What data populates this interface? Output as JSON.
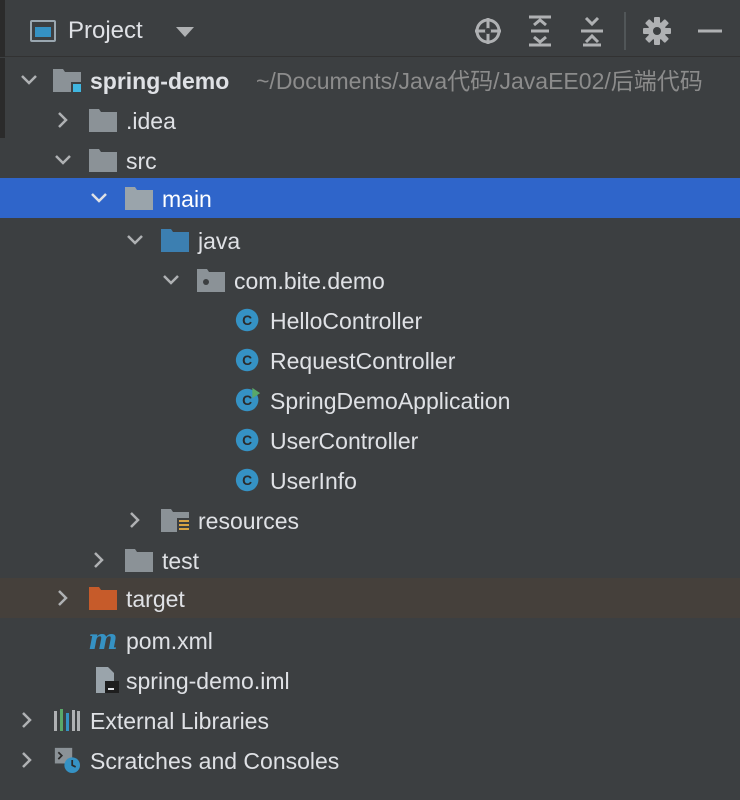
{
  "header": {
    "title": "Project",
    "icons": [
      "project-view-icon",
      "chevron-down-icon",
      "locate-icon",
      "expand-all-icon",
      "collapse-all-icon",
      "gear-icon",
      "minimize-icon"
    ]
  },
  "tree": {
    "root": {
      "name": "spring-demo",
      "path": "~/Documents/Java代码/JavaEE02/后端代码"
    },
    "idea": ".idea",
    "src": "src",
    "main": "main",
    "java": "java",
    "package": "com.bite.demo",
    "classes": {
      "c0": "HelloController",
      "c1": "RequestController",
      "c2": "SpringDemoApplication",
      "c3": "UserController",
      "c4": "UserInfo"
    },
    "resources": "resources",
    "test": "test",
    "target": "target",
    "pom": "pom.xml",
    "iml": "spring-demo.iml",
    "external": "External Libraries",
    "scratches": "Scratches and Consoles"
  },
  "colors": {
    "background": "#3c3f41",
    "selection": "#2f65ca",
    "excluded_row": "#45403b",
    "folder": "#8b9297",
    "source_folder": "#3c7fb1",
    "target_folder": "#c65b2a",
    "class_icon": "#3592c4"
  }
}
